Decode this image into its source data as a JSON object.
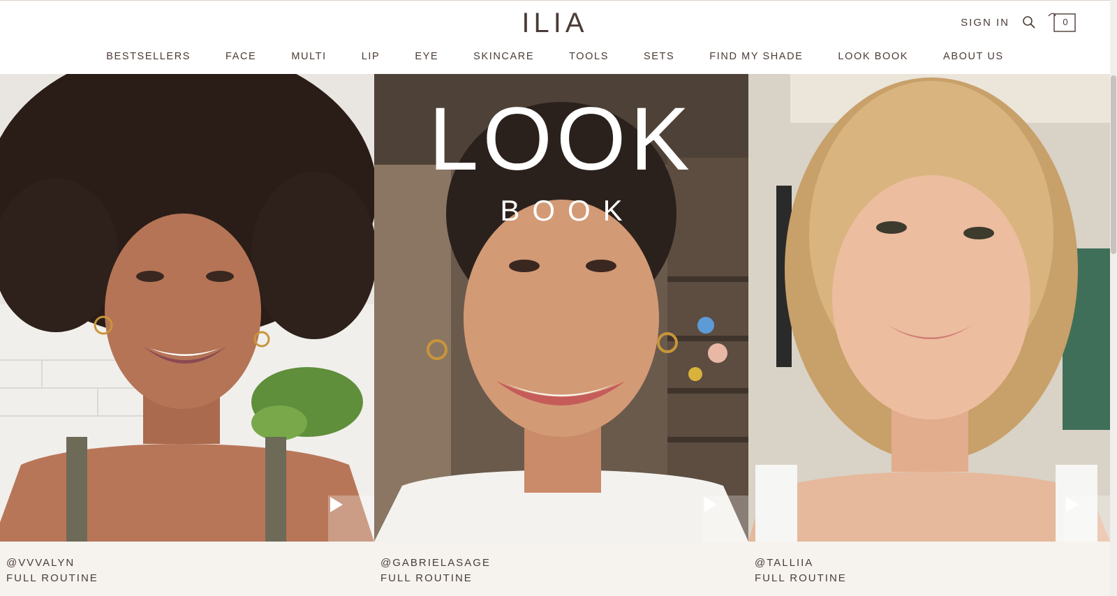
{
  "header": {
    "logo": "ILIA",
    "sign_in": "SIGN IN",
    "search_icon": "search-icon",
    "bag_icon": "shopping-bag-icon",
    "bag_count": "0"
  },
  "nav": {
    "items": [
      "BESTSELLERS",
      "FACE",
      "MULTI",
      "LIP",
      "EYE",
      "SKINCARE",
      "TOOLS",
      "SETS",
      "FIND MY SHADE",
      "LOOK BOOK",
      "ABOUT US"
    ]
  },
  "hero": {
    "title": "LOOK",
    "subtitle": "BOOK"
  },
  "videos": [
    {
      "handle": "@VVVALYN",
      "label": "FULL ROUTINE",
      "play_icon": "play-icon"
    },
    {
      "handle": "@GABRIELASAGE",
      "label": "FULL ROUTINE",
      "play_icon": "play-icon"
    },
    {
      "handle": "@TALLIIA",
      "label": "FULL ROUTINE",
      "play_icon": "play-icon"
    }
  ],
  "colors": {
    "text": "#4a3c36",
    "caption_bg": "#f6f3ef",
    "hero_text": "#ffffff"
  }
}
